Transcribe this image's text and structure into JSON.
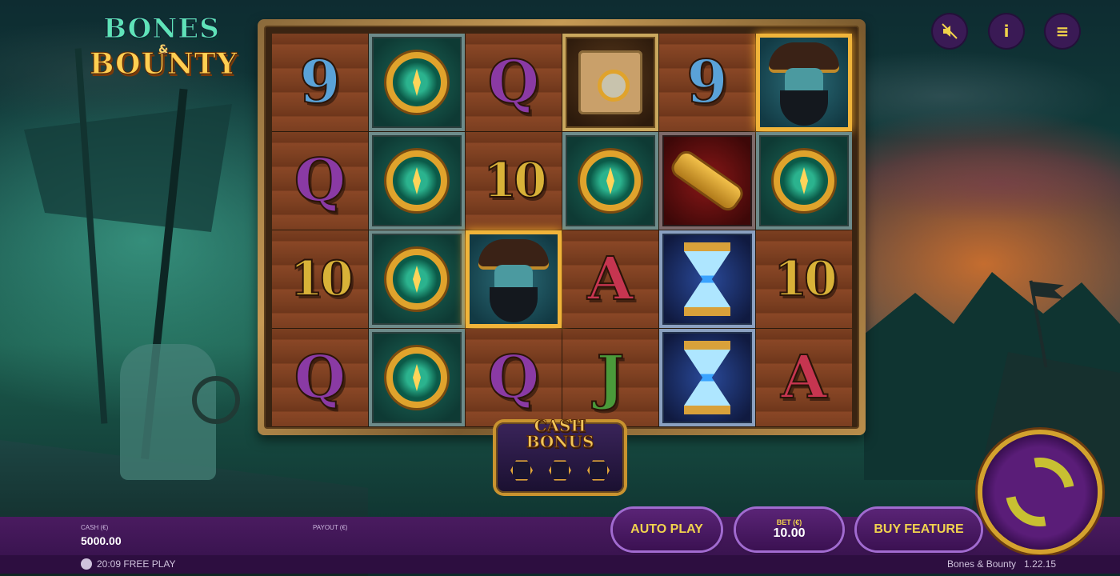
{
  "game": {
    "logo_line1": "BONES",
    "logo_amp": "&",
    "logo_line2": "BOUNTY"
  },
  "reels": [
    [
      {
        "symbol": "9",
        "kind": "letter",
        "color": "blue"
      },
      {
        "symbol": "compass",
        "kind": "icon"
      },
      {
        "symbol": "Q",
        "kind": "letter",
        "color": "purple"
      },
      {
        "symbol": "map",
        "kind": "icon"
      },
      {
        "symbol": "9",
        "kind": "letter",
        "color": "blue"
      },
      {
        "symbol": "pirate",
        "kind": "icon"
      }
    ],
    [
      {
        "symbol": "Q",
        "kind": "letter",
        "color": "purple"
      },
      {
        "symbol": "compass",
        "kind": "icon"
      },
      {
        "symbol": "10",
        "kind": "letter",
        "color": "gold"
      },
      {
        "symbol": "compass",
        "kind": "icon"
      },
      {
        "symbol": "spyglass",
        "kind": "icon"
      },
      {
        "symbol": "compass",
        "kind": "icon"
      }
    ],
    [
      {
        "symbol": "10",
        "kind": "letter",
        "color": "gold"
      },
      {
        "symbol": "compass",
        "kind": "icon"
      },
      {
        "symbol": "pirate",
        "kind": "icon"
      },
      {
        "symbol": "A",
        "kind": "letter",
        "color": "red"
      },
      {
        "symbol": "hourglass",
        "kind": "icon"
      },
      {
        "symbol": "10",
        "kind": "letter",
        "color": "gold"
      }
    ],
    [
      {
        "symbol": "Q",
        "kind": "letter",
        "color": "purple"
      },
      {
        "symbol": "compass",
        "kind": "icon"
      },
      {
        "symbol": "Q",
        "kind": "letter",
        "color": "purple"
      },
      {
        "symbol": "J",
        "kind": "letter",
        "color": "green"
      },
      {
        "symbol": "hourglass",
        "kind": "icon"
      },
      {
        "symbol": "A",
        "kind": "letter",
        "color": "red"
      }
    ]
  ],
  "cash_bonus": {
    "line1": "CASH",
    "line2": "BONUS"
  },
  "top_buttons": {
    "sound_icon": "muted-speaker-icon",
    "info_glyph": "i",
    "menu_glyph": "≡"
  },
  "bottom": {
    "cash_label": "CASH (€)",
    "cash_value": "5000.00",
    "payout_label": "PAYOUT (€)",
    "autoplay_label": "AUTO PLAY",
    "bet_label": "BET (€)",
    "bet_value": "10.00",
    "buy_feature_label": "BUY FEATURE"
  },
  "info_bar": {
    "time_mode": "20:09 FREE PLAY",
    "game_version": "Bones & Bounty   1.22.15"
  },
  "colors": {
    "accent_purple": "#4a1b60",
    "gold": "#f1d34e",
    "pill_border": "#a16bd0"
  }
}
